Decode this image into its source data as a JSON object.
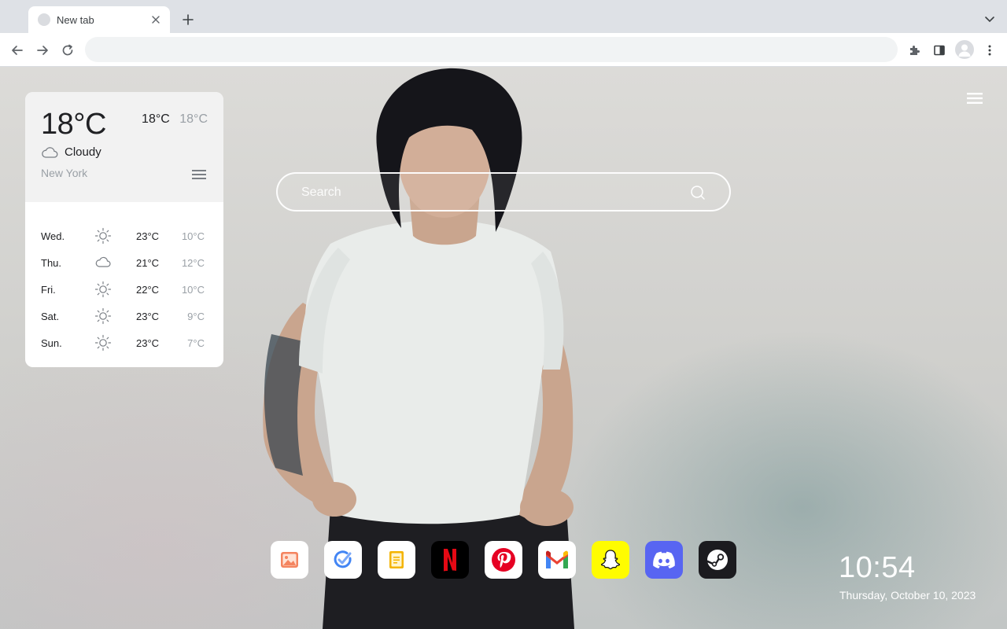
{
  "browser": {
    "tab": {
      "title": "New tab",
      "favicon": "globe-icon"
    },
    "omnibox": {
      "value": "",
      "placeholder": ""
    },
    "icons": {
      "new_tab": "plus-icon",
      "tab_menu": "chevron-down-icon",
      "back": "arrow-left-icon",
      "forward": "arrow-right-icon",
      "reload": "reload-icon",
      "extensions": "puzzle-icon",
      "side_panel": "side-panel-icon",
      "profile": "avatar-icon",
      "menu": "kebab-icon"
    }
  },
  "weather": {
    "current_temp": "18°C",
    "today_high": "18°C",
    "today_low": "18°C",
    "condition": "Cloudy",
    "city": "New York",
    "forecast": [
      {
        "day": "Wed.",
        "icon": "sun-icon",
        "high": "23°C",
        "low": "10°C"
      },
      {
        "day": "Thu.",
        "icon": "cloud-icon",
        "high": "21°C",
        "low": "12°C"
      },
      {
        "day": "Fri.",
        "icon": "sun-icon",
        "high": "22°C",
        "low": "10°C"
      },
      {
        "day": "Sat.",
        "icon": "sun-icon",
        "high": "23°C",
        "low": "9°C"
      },
      {
        "day": "Sun.",
        "icon": "sun-icon",
        "high": "23°C",
        "low": "7°C"
      }
    ]
  },
  "search": {
    "placeholder": "Search"
  },
  "dock": [
    {
      "name": "photos",
      "icon": "photos-icon",
      "bg": "#ffffff"
    },
    {
      "name": "tasks",
      "icon": "check-circle-icon",
      "bg": "#ffffff"
    },
    {
      "name": "notes",
      "icon": "notes-icon",
      "bg": "#ffffff"
    },
    {
      "name": "netflix",
      "icon": "netflix-icon",
      "bg": "#000000",
      "label": "N"
    },
    {
      "name": "pinterest",
      "icon": "pinterest-icon",
      "bg": "#ffffff"
    },
    {
      "name": "gmail",
      "icon": "gmail-icon",
      "bg": "#ffffff"
    },
    {
      "name": "snapchat",
      "icon": "snapchat-icon",
      "bg": "#fffc00"
    },
    {
      "name": "discord",
      "icon": "discord-icon",
      "bg": "#5865f2"
    },
    {
      "name": "steam",
      "icon": "steam-icon",
      "bg": "#1b1b1f"
    }
  ],
  "clock": {
    "time": "10:54",
    "date": "Thursday, October 10, 2023"
  },
  "colors": {
    "netflix_red": "#e50914",
    "pinterest_red": "#e60023",
    "notes_yellow": "#f4b400",
    "tasks_blue": "#4285f4",
    "photos_orange": "#f4845f"
  }
}
